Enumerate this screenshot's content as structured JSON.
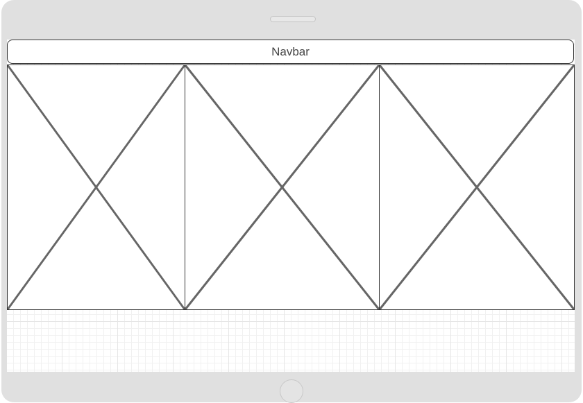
{
  "navbar": {
    "label": "Navbar"
  },
  "image_placeholders": [
    {
      "icon": "image-placeholder-cross"
    },
    {
      "icon": "image-placeholder-cross"
    },
    {
      "icon": "image-placeholder-cross"
    }
  ],
  "device": {
    "frame_color": "#e0e0e0",
    "has_speaker": true,
    "has_home_button": true
  }
}
